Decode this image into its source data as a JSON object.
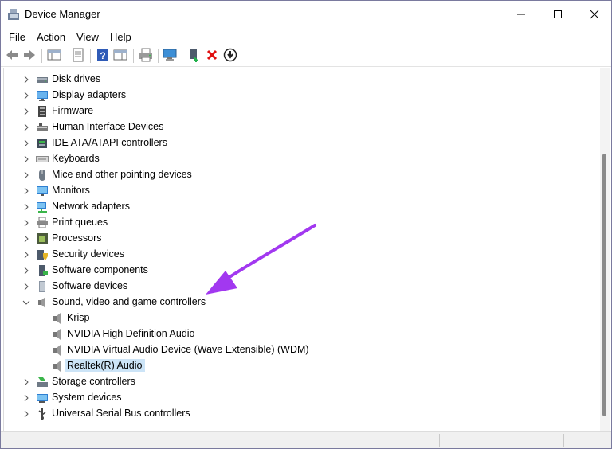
{
  "window": {
    "title": "Device Manager"
  },
  "colors": {
    "accent_arrow": "#a238f0",
    "selection": "#cce4f7",
    "toolbar_red": "#e01010"
  },
  "menu": {
    "file": "File",
    "action": "Action",
    "view": "View",
    "help": "Help"
  },
  "toolbar": {
    "icons": [
      "back-icon",
      "forward-icon",
      "show-hide-console-tree-icon",
      "properties-icon",
      "help-icon",
      "action-pane-icon",
      "print-icon",
      "scan-hardware-icon",
      "update-driver-icon",
      "uninstall-icon",
      "disable-device-icon"
    ]
  },
  "tree": {
    "disk_drives": "Disk drives",
    "display_adapters": "Display adapters",
    "firmware": "Firmware",
    "hid": "Human Interface Devices",
    "ide": "IDE ATA/ATAPI controllers",
    "keyboards": "Keyboards",
    "mice": "Mice and other pointing devices",
    "monitors": "Monitors",
    "network": "Network adapters",
    "print_queues": "Print queues",
    "processors": "Processors",
    "security": "Security devices",
    "software_components": "Software components",
    "software_devices": "Software devices",
    "sound": "Sound, video and game controllers",
    "sound_children": {
      "krisp": "Krisp",
      "nvidia_hd": "NVIDIA High Definition Audio",
      "nvidia_virtual": "NVIDIA Virtual Audio Device (Wave Extensible) (WDM)",
      "realtek": "Realtek(R) Audio"
    },
    "storage": "Storage controllers",
    "system": "System devices",
    "usb": "Universal Serial Bus controllers"
  }
}
